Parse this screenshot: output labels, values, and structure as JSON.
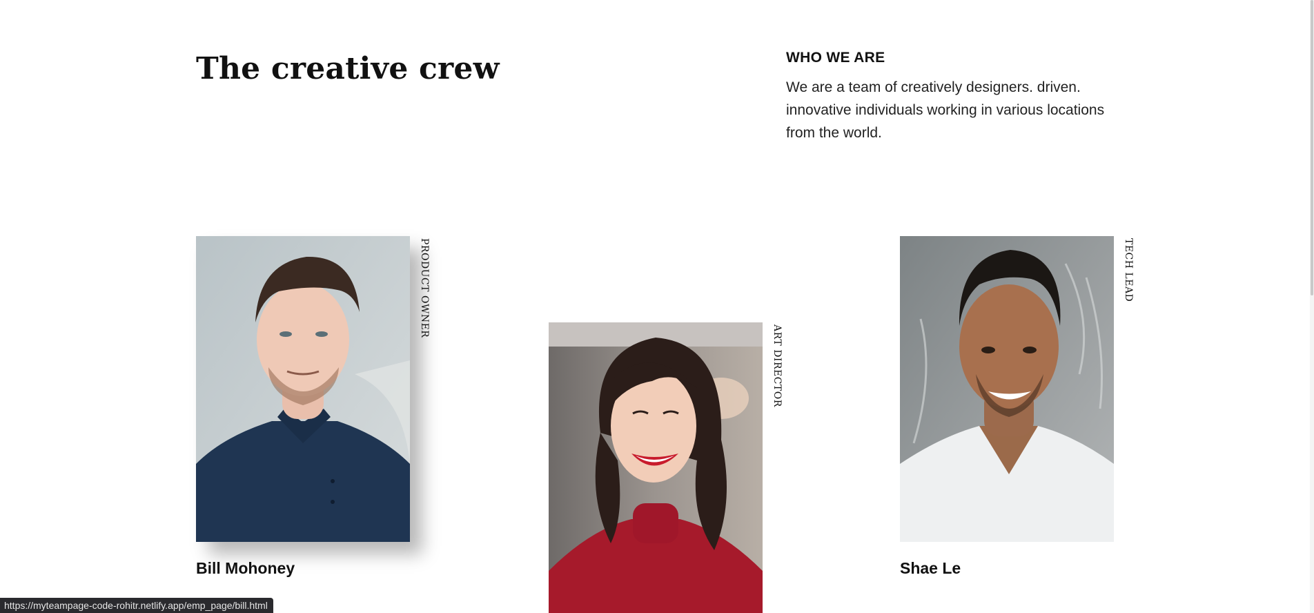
{
  "page": {
    "title": "The creative crew"
  },
  "about": {
    "heading": "WHO WE ARE",
    "text": "We are a team of creatively designers. driven. innovative individuals working in various locations from the world."
  },
  "team": [
    {
      "name": "Bill Mohoney",
      "role": "PRODUCT OWNER"
    },
    {
      "name": "",
      "role": "ART DIRECTOR"
    },
    {
      "name": "Shae Le",
      "role": "TECH LEAD"
    }
  ],
  "status_bar": {
    "url": "https://myteampage-code-rohitr.netlify.app/emp_page/bill.html"
  }
}
